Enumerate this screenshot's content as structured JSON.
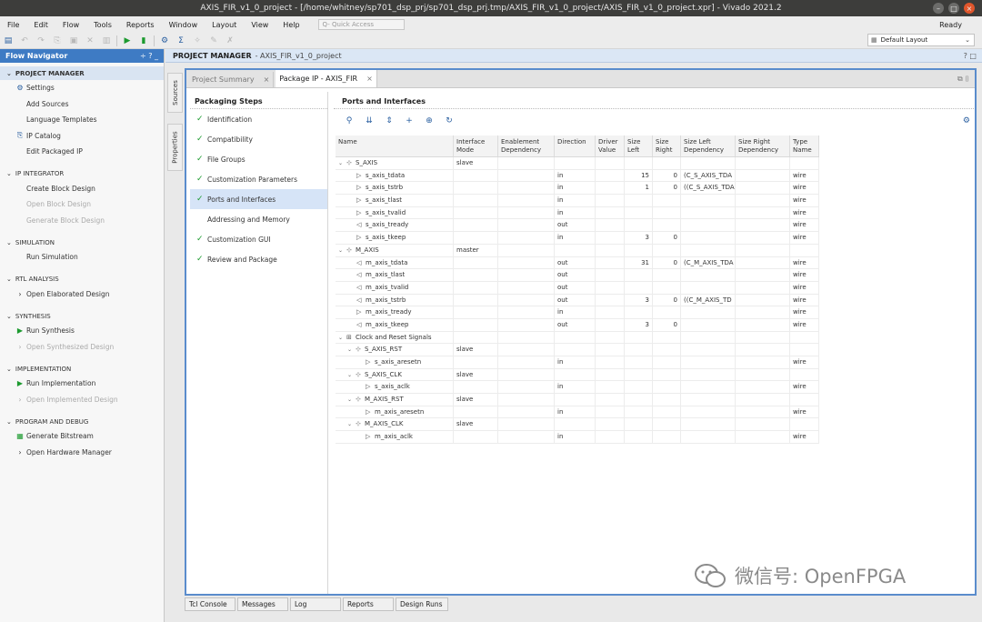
{
  "window": {
    "title": "AXIS_FIR_v1_0_project - [/home/whitney/sp701_dsp_prj/sp701_dsp_prj.tmp/AXIS_FIR_v1_0_project/AXIS_FIR_v1_0_project.xpr] - Vivado 2021.2"
  },
  "menu": {
    "items": [
      "File",
      "Edit",
      "Flow",
      "Tools",
      "Reports",
      "Window",
      "Layout",
      "View",
      "Help"
    ],
    "quick_access": "Q- Quick Access",
    "status": "Ready"
  },
  "toolbar": {
    "layout_select": "Default Layout"
  },
  "flow_navigator": {
    "title": "Flow Navigator",
    "header_icons": "÷ ? _",
    "sections": [
      {
        "label": "PROJECT MANAGER",
        "items": [
          {
            "label": "Settings",
            "icon": "gear-icon",
            "dim": false
          },
          {
            "label": "Add Sources",
            "icon": "",
            "dim": false
          },
          {
            "label": "Language Templates",
            "icon": "",
            "dim": false
          },
          {
            "label": "IP Catalog",
            "icon": "ip-catalog-icon",
            "dim": false
          },
          {
            "label": "Edit Packaged IP",
            "icon": "",
            "dim": false
          }
        ]
      },
      {
        "label": "IP INTEGRATOR",
        "items": [
          {
            "label": "Create Block Design",
            "icon": "",
            "dim": false
          },
          {
            "label": "Open Block Design",
            "icon": "",
            "dim": true
          },
          {
            "label": "Generate Block Design",
            "icon": "",
            "dim": true
          }
        ]
      },
      {
        "label": "SIMULATION",
        "items": [
          {
            "label": "Run Simulation",
            "icon": "",
            "dim": false
          }
        ]
      },
      {
        "label": "RTL ANALYSIS",
        "items": [
          {
            "label": "Open Elaborated Design",
            "icon": "chevron-right-icon",
            "dim": false
          }
        ]
      },
      {
        "label": "SYNTHESIS",
        "items": [
          {
            "label": "Run Synthesis",
            "icon": "run-icon",
            "dim": false
          },
          {
            "label": "Open Synthesized Design",
            "icon": "chevron-right-icon",
            "dim": true
          }
        ]
      },
      {
        "label": "IMPLEMENTATION",
        "items": [
          {
            "label": "Run Implementation",
            "icon": "run-icon",
            "dim": false
          },
          {
            "label": "Open Implemented Design",
            "icon": "chevron-right-icon",
            "dim": true
          }
        ]
      },
      {
        "label": "PROGRAM AND DEBUG",
        "items": [
          {
            "label": "Generate Bitstream",
            "icon": "bitstream-icon",
            "dim": false
          },
          {
            "label": "Open Hardware Manager",
            "icon": "chevron-right-icon",
            "dim": false
          }
        ]
      }
    ]
  },
  "project_manager": {
    "title": "PROJECT MANAGER",
    "subtitle": "- AXIS_FIR_v1_0_project",
    "icons": "? □"
  },
  "side_tabs": [
    "Sources",
    "Properties"
  ],
  "tabs": [
    {
      "label": "Project Summary",
      "active": false
    },
    {
      "label": "Package IP - AXIS_FIR",
      "active": true
    }
  ],
  "tab_icons": "⧉ ⌷",
  "packaging_steps": {
    "title": "Packaging Steps",
    "steps": [
      {
        "label": "Identification",
        "done": true,
        "selected": false
      },
      {
        "label": "Compatibility",
        "done": true,
        "selected": false
      },
      {
        "label": "File Groups",
        "done": true,
        "selected": false
      },
      {
        "label": "Customization Parameters",
        "done": true,
        "selected": false
      },
      {
        "label": "Ports and Interfaces",
        "done": true,
        "selected": true
      },
      {
        "label": "Addressing and Memory",
        "done": false,
        "selected": false
      },
      {
        "label": "Customization GUI",
        "done": true,
        "selected": false
      },
      {
        "label": "Review and Package",
        "done": true,
        "selected": false
      }
    ]
  },
  "ports": {
    "title": "Ports and Interfaces",
    "toolbar": [
      "search-icon",
      "collapse-all-icon",
      "expand-all-icon",
      "add-icon",
      "auto-infer-icon",
      "refresh-icon"
    ],
    "columns": [
      "Name",
      "Interface Mode",
      "Enablement Dependency",
      "Direction",
      "Driver Value",
      "Size Left",
      "Size Right",
      "Size Left Dependency",
      "Size Right Dependency",
      "Type Name"
    ],
    "rows": [
      {
        "level": 0,
        "toggle": "⌄",
        "icon": "⊹",
        "name": "S_AXIS",
        "mode": "slave",
        "enable": "",
        "dir": "",
        "driver": "",
        "sl": "",
        "sr": "",
        "sld": "",
        "srd": "",
        "type": ""
      },
      {
        "level": 2,
        "toggle": "",
        "icon": "▷",
        "name": "s_axis_tdata",
        "mode": "",
        "enable": "",
        "dir": "in",
        "driver": "",
        "sl": "15",
        "sr": "0",
        "sld": "(C_S_AXIS_TDA",
        "srd": "",
        "type": "wire"
      },
      {
        "level": 2,
        "toggle": "",
        "icon": "▷",
        "name": "s_axis_tstrb",
        "mode": "",
        "enable": "",
        "dir": "in",
        "driver": "",
        "sl": "1",
        "sr": "0",
        "sld": "((C_S_AXIS_TDA",
        "srd": "",
        "type": "wire"
      },
      {
        "level": 2,
        "toggle": "",
        "icon": "▷",
        "name": "s_axis_tlast",
        "mode": "",
        "enable": "",
        "dir": "in",
        "driver": "",
        "sl": "",
        "sr": "",
        "sld": "",
        "srd": "",
        "type": "wire"
      },
      {
        "level": 2,
        "toggle": "",
        "icon": "▷",
        "name": "s_axis_tvalid",
        "mode": "",
        "enable": "",
        "dir": "in",
        "driver": "",
        "sl": "",
        "sr": "",
        "sld": "",
        "srd": "",
        "type": "wire"
      },
      {
        "level": 2,
        "toggle": "",
        "icon": "◁",
        "name": "s_axis_tready",
        "mode": "",
        "enable": "",
        "dir": "out",
        "driver": "",
        "sl": "",
        "sr": "",
        "sld": "",
        "srd": "",
        "type": "wire"
      },
      {
        "level": 2,
        "toggle": "",
        "icon": "▷",
        "name": "s_axis_tkeep",
        "mode": "",
        "enable": "",
        "dir": "in",
        "driver": "",
        "sl": "3",
        "sr": "0",
        "sld": "",
        "srd": "",
        "type": "wire"
      },
      {
        "level": 0,
        "toggle": "⌄",
        "icon": "⊹",
        "name": "M_AXIS",
        "mode": "master",
        "enable": "",
        "dir": "",
        "driver": "",
        "sl": "",
        "sr": "",
        "sld": "",
        "srd": "",
        "type": ""
      },
      {
        "level": 2,
        "toggle": "",
        "icon": "◁",
        "name": "m_axis_tdata",
        "mode": "",
        "enable": "",
        "dir": "out",
        "driver": "",
        "sl": "31",
        "sr": "0",
        "sld": "(C_M_AXIS_TDA",
        "srd": "",
        "type": "wire"
      },
      {
        "level": 2,
        "toggle": "",
        "icon": "◁",
        "name": "m_axis_tlast",
        "mode": "",
        "enable": "",
        "dir": "out",
        "driver": "",
        "sl": "",
        "sr": "",
        "sld": "",
        "srd": "",
        "type": "wire"
      },
      {
        "level": 2,
        "toggle": "",
        "icon": "◁",
        "name": "m_axis_tvalid",
        "mode": "",
        "enable": "",
        "dir": "out",
        "driver": "",
        "sl": "",
        "sr": "",
        "sld": "",
        "srd": "",
        "type": "wire"
      },
      {
        "level": 2,
        "toggle": "",
        "icon": "◁",
        "name": "m_axis_tstrb",
        "mode": "",
        "enable": "",
        "dir": "out",
        "driver": "",
        "sl": "3",
        "sr": "0",
        "sld": "((C_M_AXIS_TD",
        "srd": "",
        "type": "wire"
      },
      {
        "level": 2,
        "toggle": "",
        "icon": "▷",
        "name": "m_axis_tready",
        "mode": "",
        "enable": "",
        "dir": "in",
        "driver": "",
        "sl": "",
        "sr": "",
        "sld": "",
        "srd": "",
        "type": "wire"
      },
      {
        "level": 2,
        "toggle": "",
        "icon": "◁",
        "name": "m_axis_tkeep",
        "mode": "",
        "enable": "",
        "dir": "out",
        "driver": "",
        "sl": "3",
        "sr": "0",
        "sld": "",
        "srd": "",
        "type": "wire"
      },
      {
        "level": 0,
        "toggle": "⌄",
        "icon": "⊞",
        "name": "Clock and Reset Signals",
        "mode": "",
        "enable": "",
        "dir": "",
        "driver": "",
        "sl": "",
        "sr": "",
        "sld": "",
        "srd": "",
        "type": ""
      },
      {
        "level": 1,
        "toggle": "⌄",
        "icon": "⊹",
        "name": "S_AXIS_RST",
        "mode": "slave",
        "enable": "",
        "dir": "",
        "driver": "",
        "sl": "",
        "sr": "",
        "sld": "",
        "srd": "",
        "type": ""
      },
      {
        "level": 3,
        "toggle": "",
        "icon": "▷",
        "name": "s_axis_aresetn",
        "mode": "",
        "enable": "",
        "dir": "in",
        "driver": "",
        "sl": "",
        "sr": "",
        "sld": "",
        "srd": "",
        "type": "wire"
      },
      {
        "level": 1,
        "toggle": "⌄",
        "icon": "⊹",
        "name": "S_AXIS_CLK",
        "mode": "slave",
        "enable": "",
        "dir": "",
        "driver": "",
        "sl": "",
        "sr": "",
        "sld": "",
        "srd": "",
        "type": ""
      },
      {
        "level": 3,
        "toggle": "",
        "icon": "▷",
        "name": "s_axis_aclk",
        "mode": "",
        "enable": "",
        "dir": "in",
        "driver": "",
        "sl": "",
        "sr": "",
        "sld": "",
        "srd": "",
        "type": "wire"
      },
      {
        "level": 1,
        "toggle": "⌄",
        "icon": "⊹",
        "name": "M_AXIS_RST",
        "mode": "slave",
        "enable": "",
        "dir": "",
        "driver": "",
        "sl": "",
        "sr": "",
        "sld": "",
        "srd": "",
        "type": ""
      },
      {
        "level": 3,
        "toggle": "",
        "icon": "▷",
        "name": "m_axis_aresetn",
        "mode": "",
        "enable": "",
        "dir": "in",
        "driver": "",
        "sl": "",
        "sr": "",
        "sld": "",
        "srd": "",
        "type": "wire"
      },
      {
        "level": 1,
        "toggle": "⌄",
        "icon": "⊹",
        "name": "M_AXIS_CLK",
        "mode": "slave",
        "enable": "",
        "dir": "",
        "driver": "",
        "sl": "",
        "sr": "",
        "sld": "",
        "srd": "",
        "type": ""
      },
      {
        "level": 3,
        "toggle": "",
        "icon": "▷",
        "name": "m_axis_aclk",
        "mode": "",
        "enable": "",
        "dir": "in",
        "driver": "",
        "sl": "",
        "sr": "",
        "sld": "",
        "srd": "",
        "type": "wire"
      }
    ]
  },
  "bottom_tabs": [
    "Tcl Console",
    "Messages",
    "Log",
    "Reports",
    "Design Runs"
  ],
  "watermark": "微信号: OpenFPGA",
  "colors": {
    "accent": "#3e7bc4",
    "panel_border": "#5a8ccc",
    "check": "#1c9a2f",
    "selected": "#d6e4f7"
  }
}
